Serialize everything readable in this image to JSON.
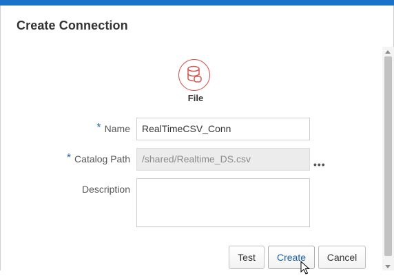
{
  "dialog": {
    "title": "Create Connection"
  },
  "connection_type": {
    "icon": "database-icon",
    "label": "File"
  },
  "form": {
    "required_marker": "*",
    "name": {
      "label": "Name",
      "value": "RealTimeCSV_Conn"
    },
    "catalog_path": {
      "label": "Catalog Path",
      "value": "/shared/Realtime_DS.csv",
      "browse_label": "•••"
    },
    "description": {
      "label": "Description",
      "value": ""
    }
  },
  "buttons": {
    "test": "Test",
    "create": "Create",
    "cancel": "Cancel"
  },
  "colors": {
    "accent": "#1a73c8",
    "icon": "#d9534f",
    "primary_text": "#1a5fa8"
  }
}
